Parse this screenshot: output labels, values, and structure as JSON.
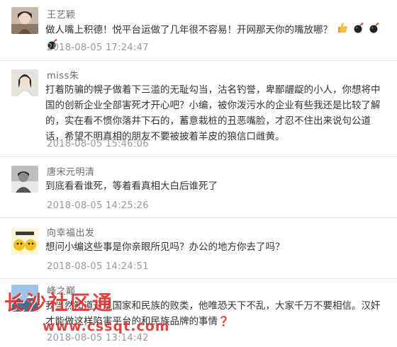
{
  "comments": [
    {
      "user": "王艺颖",
      "text": "做人嘴上积德！悦平台运做了几年很不容易！开网那天你的嘴放哪？",
      "emoji": [
        "thumbs-up",
        "bomb",
        "bomb",
        "bomb"
      ],
      "time": "2018-08-05 17:24:47"
    },
    {
      "user": "miss朱",
      "text": "打着防骗的幌子做着下三滥的无耻勾当，沽名钓誉，卑鄙龌龊的小人，你想将中国的创新企业全部害死才开心吧？小编，被你泼污水的企业有些我还是比较了解的，实在看不惯你落井下石的，蓄意栽桩的丑恶嘴脸，才忍不住出来说句公道话，希望不明真相的朋友不要被披着羊皮的狼信口雌黄。",
      "time": "2018-08-05 15:46:06"
    },
    {
      "user": "唐宋元明清",
      "text": "到底看看谁死，等着看真相大白后谁死了",
      "time": "2018-08-05 14:25:26"
    },
    {
      "user": "向幸福出发",
      "text": "想问小编这些事是你亲眼所见吗？办公的地方你去了吗？",
      "time": "2018-08-05 14:24:51"
    },
    {
      "user": "峰之巅",
      "text": "我当然知道这是国家和民族的败类，他唯恐天下不乱，大家千万不要相信。汉奸才能做这样陷害平台的和民族品牌的事情",
      "text_mark": "❓",
      "time": "2018-08-05 13:14:42"
    }
  ],
  "watermark": {
    "line1": "长沙社区通",
    "line2": "www.cssqt.com"
  },
  "colors": {
    "username": "#6b6b6b",
    "body_text": "#333333",
    "timestamp": "#999999",
    "divider": "#e6e6e6",
    "watermark": "#e0322d"
  }
}
